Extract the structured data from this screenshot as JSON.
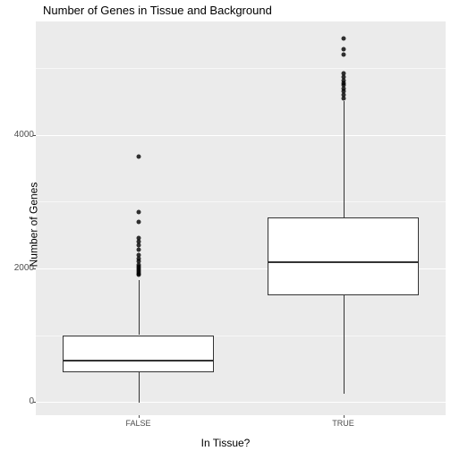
{
  "chart_data": {
    "type": "boxplot",
    "title": "Number of Genes in Tissue and Background",
    "xlabel": "In Tissue?",
    "ylabel": "Number of Genes",
    "categories": [
      "FALSE",
      "TRUE"
    ],
    "ylim": [
      -200,
      5700
    ],
    "yticks": [
      0,
      2000,
      4000
    ],
    "series": [
      {
        "name": "FALSE",
        "q1": 450,
        "median": 630,
        "q3": 1000,
        "whisker_low": -10,
        "whisker_high": 1820,
        "outliers": [
          1900,
          1920,
          1950,
          1970,
          2000,
          2020,
          2050,
          2100,
          2150,
          2200,
          2280,
          2350,
          2400,
          2450,
          2700,
          2850,
          3680
        ]
      },
      {
        "name": "TRUE",
        "q1": 1600,
        "median": 2100,
        "q3": 2770,
        "whisker_low": 120,
        "whisker_high": 4500,
        "outliers": [
          4550,
          4600,
          4650,
          4700,
          4750,
          4780,
          4820,
          4870,
          4920,
          5200,
          5280,
          5450
        ]
      }
    ]
  }
}
